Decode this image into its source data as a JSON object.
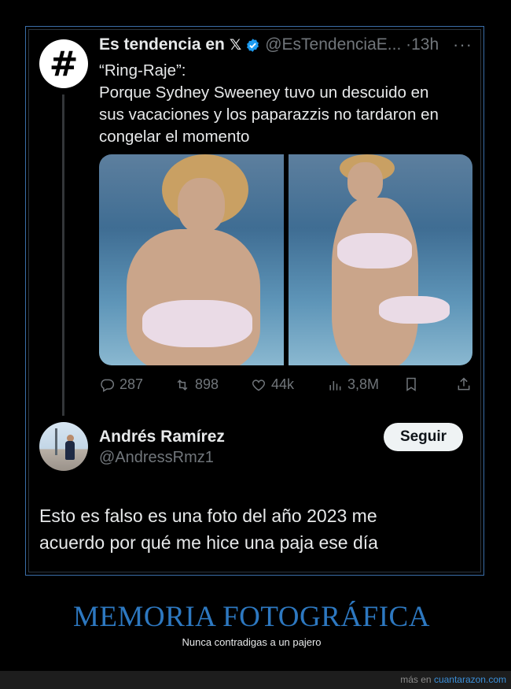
{
  "tweet": {
    "avatar_glyph": "#",
    "name": "Es tendencia en",
    "x_logo": "𝕏",
    "handle": "@EsTendenciaE...",
    "sep": "·",
    "time": "13h",
    "more": "···",
    "text_lines": [
      "“Ring-Raje”:",
      "Porque Sydney Sweeney tuvo un descuido en",
      "sus vacaciones y los paparazzis no tardaron en",
      "congelar el momento"
    ],
    "stats": {
      "replies": "287",
      "reposts": "898",
      "likes": "44k",
      "views": "3,8M"
    }
  },
  "reply": {
    "name": "Andrés Ramírez",
    "handle": "@AndressRmz1",
    "follow_label": "Seguir",
    "text_lines": [
      "Esto es falso es una foto del año 2023 me",
      "acuerdo por qué me hice una paja ese día"
    ]
  },
  "caption": {
    "headline": "MEMORIA FOTOGRÁFICA",
    "subline": "Nunca contradigas a un pajero"
  },
  "footer": {
    "prefix": "más en",
    "link": "cuantarazon.com"
  },
  "colors": {
    "accent": "#2d78c0",
    "verified": "#1d9bf0",
    "muted": "#71767b"
  }
}
